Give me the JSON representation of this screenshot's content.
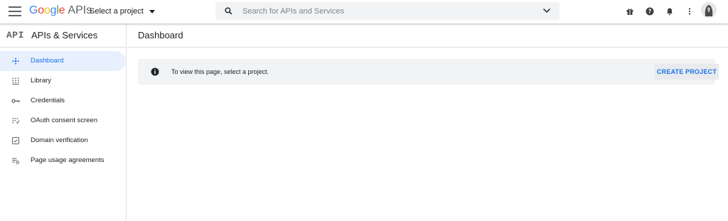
{
  "topbar": {
    "logo_google": "Google",
    "logo_apis": "APIs",
    "project_selector": "Select a project",
    "search_placeholder": "Search for APIs and Services",
    "icons": [
      "gift-icon",
      "help-icon",
      "notifications-icon",
      "more-vert-icon",
      "avatar"
    ]
  },
  "sidebar": {
    "badge": "API",
    "title": "APIs & Services",
    "items": [
      {
        "label": "Dashboard",
        "icon": "dashboard-icon",
        "active": true
      },
      {
        "label": "Library",
        "icon": "library-icon",
        "active": false
      },
      {
        "label": "Credentials",
        "icon": "key-icon",
        "active": false
      },
      {
        "label": "OAuth consent screen",
        "icon": "consent-icon",
        "active": false
      },
      {
        "label": "Domain verification",
        "icon": "verification-icon",
        "active": false
      },
      {
        "label": "Page usage agreements",
        "icon": "settings-list-icon",
        "active": false
      }
    ]
  },
  "main": {
    "title": "Dashboard",
    "notice_text": "To view this page, select a project.",
    "create_button": "CREATE PROJECT"
  },
  "colors": {
    "accent": "#1a73e8",
    "active_bg": "#e8f0fe",
    "notice_bg": "#f1f3f4",
    "icon_grey": "#5f6368"
  }
}
